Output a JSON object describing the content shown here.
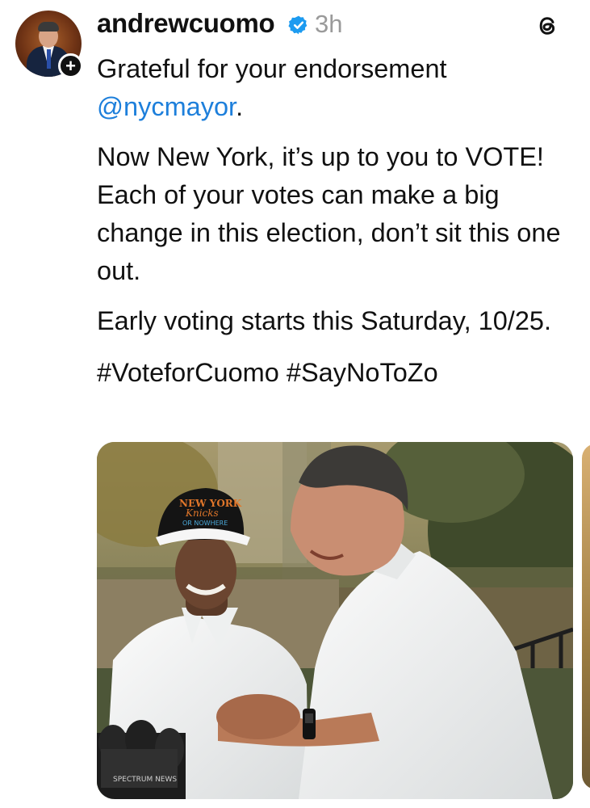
{
  "post": {
    "username": "andrewcuomo",
    "timestamp": "3h",
    "verified": true,
    "line1": "Grateful for your endorsement",
    "mention": "@nycmayor",
    "mention_suffix": ".",
    "paragraph2": "Now New York, it’s up to you to VOTE! Each of your votes can make a big change in this election, don’t sit this one out.",
    "paragraph3": "Early voting starts this Saturday, 10/25.",
    "hashtags": "#VoteforCuomo #SayNoToZo"
  },
  "icons": {
    "follow": "plus-icon",
    "verified": "verified-badge-icon",
    "app": "threads-logo-icon"
  },
  "colors": {
    "mention": "#1d7fdb",
    "verified_badge": "#1d9bf0",
    "timestamp": "#9a9a9a"
  },
  "media": {
    "cap_text_line1": "NEW YORK",
    "cap_text_line2": "Knicks",
    "cap_text_line3": "OR NOWHERE",
    "mic_label": "SPECTRUM NEWS"
  }
}
